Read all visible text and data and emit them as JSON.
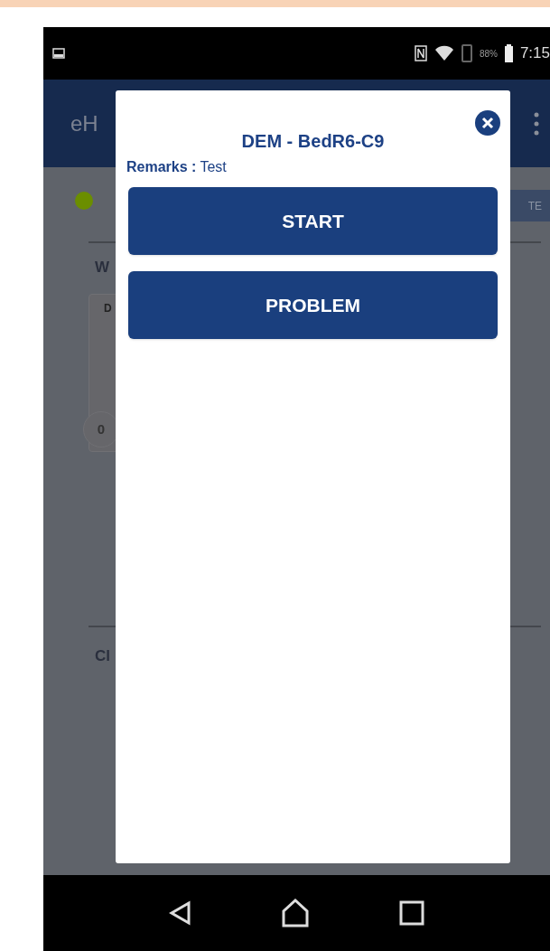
{
  "status_bar": {
    "battery": "88%",
    "time": "7:15"
  },
  "app_bar": {
    "title": "eH"
  },
  "background": {
    "action_button": "TE",
    "section_1": "W",
    "card_label": "D",
    "card_count": "0",
    "section_2": "Cl"
  },
  "dialog": {
    "title": "DEM - BedR6-C9",
    "remarks_label": "Remarks :",
    "remarks_value": "Test",
    "buttons": [
      {
        "label": "START"
      },
      {
        "label": "PROBLEM"
      }
    ]
  }
}
